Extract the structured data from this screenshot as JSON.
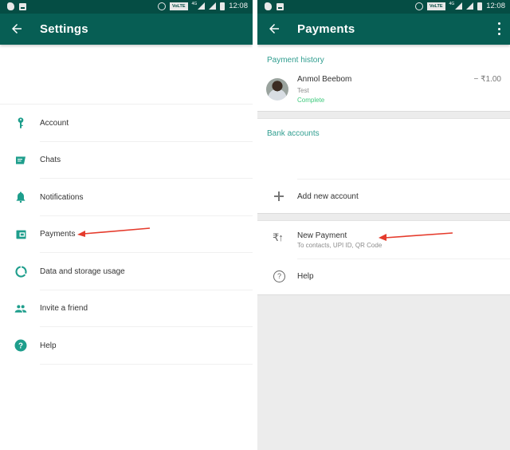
{
  "status_bar": {
    "time": "12:08",
    "network_badge": "VoLTE",
    "network_type": "4G",
    "left_icons": [
      "evernote-icon",
      "image-icon"
    ],
    "right_icons": [
      "alarm-icon",
      "volte-icon",
      "signal-4g-icon",
      "signal-icon",
      "battery-icon"
    ]
  },
  "colors": {
    "status_bar": "#054d44",
    "app_bar": "#075e54",
    "accent": "#2f9d8f",
    "icon_teal": "#1e9e8c",
    "complete_green": "#3fc97d",
    "annotation_arrow": "#e53b2c"
  },
  "settings_screen": {
    "title": "Settings",
    "back_icon": "arrow-back-icon",
    "items": [
      {
        "label": "Account",
        "icon": "key-icon"
      },
      {
        "label": "Chats",
        "icon": "chat-icon"
      },
      {
        "label": "Notifications",
        "icon": "bell-icon"
      },
      {
        "label": "Payments",
        "icon": "wallet-icon"
      },
      {
        "label": "Data and storage usage",
        "icon": "data-usage-icon"
      },
      {
        "label": "Invite a friend",
        "icon": "people-icon"
      },
      {
        "label": "Help",
        "icon": "help-icon"
      }
    ]
  },
  "payments_screen": {
    "title": "Payments",
    "back_icon": "arrow-back-icon",
    "menu_icon": "more-vert-icon",
    "payment_history": {
      "title": "Payment history",
      "transactions": [
        {
          "name": "Anmol Beebom",
          "note": "Test",
          "status": "Complete",
          "amount": "− ₹1.00"
        }
      ]
    },
    "bank_accounts": {
      "title": "Bank accounts",
      "add_label": "Add new account"
    },
    "new_payment": {
      "label": "New Payment",
      "subtitle": "To contacts, UPI ID, QR Code",
      "icon": "₹↑"
    },
    "help": {
      "label": "Help",
      "icon": "?"
    }
  }
}
